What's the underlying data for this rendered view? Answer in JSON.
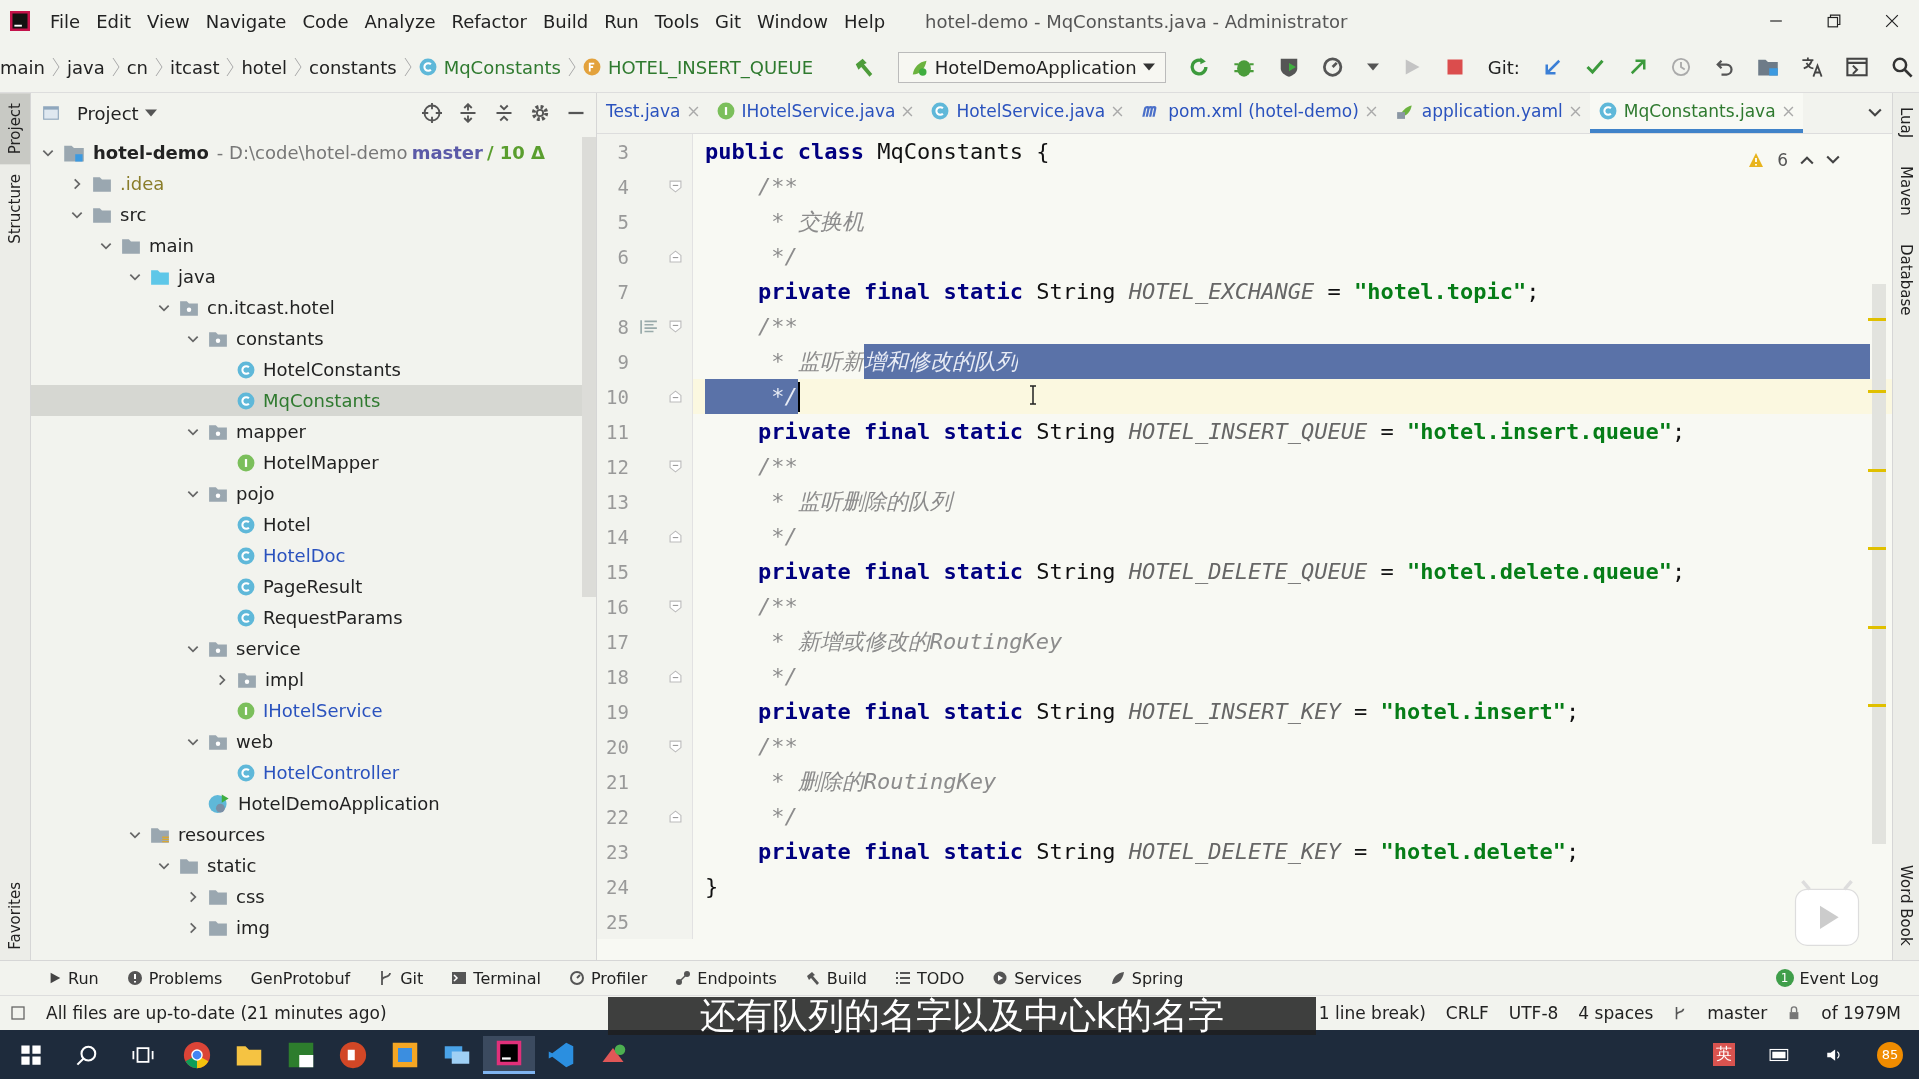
{
  "window": {
    "title": "hotel-demo - MqConstants.java - Administrator"
  },
  "menu": [
    "File",
    "Edit",
    "View",
    "Navigate",
    "Code",
    "Analyze",
    "Refactor",
    "Build",
    "Run",
    "Tools",
    "Git",
    "Window",
    "Help"
  ],
  "breadcrumbs": [
    {
      "label": "main",
      "kind": "plain"
    },
    {
      "label": "java",
      "kind": "plain"
    },
    {
      "label": "cn",
      "kind": "plain"
    },
    {
      "label": "itcast",
      "kind": "plain"
    },
    {
      "label": "hotel",
      "kind": "plain"
    },
    {
      "label": "constants",
      "kind": "plain"
    },
    {
      "label": "MqConstants",
      "kind": "class"
    },
    {
      "label": "HOTEL_INSERT_QUEUE",
      "kind": "field"
    }
  ],
  "run_config": "HotelDemoApplication",
  "git_label": "Git:",
  "left_strip": [
    {
      "label": "Project",
      "selected": true
    },
    {
      "label": "Structure",
      "selected": false
    },
    {
      "label": "Favorites",
      "selected": false
    }
  ],
  "right_strip": [
    "LuaJ",
    "Maven",
    "Database",
    "Word Book"
  ],
  "project": {
    "title": "Project",
    "tree": [
      {
        "label": "hotel-demo",
        "kind": "module",
        "color": "#222222",
        "expanded": true,
        "selected": false,
        "path": "- D:\\code\\hotel-demo",
        "branch": "master",
        "changes": "/ 10 Δ",
        "children": [
          {
            "label": ".idea",
            "kind": "folder",
            "color": "#8a7d2a",
            "expanded": false,
            "selected": false
          },
          {
            "label": "src",
            "kind": "folder",
            "color": "#222222",
            "expanded": true,
            "selected": false,
            "children": [
              {
                "label": "main",
                "kind": "folder",
                "color": "#222222",
                "expanded": true,
                "selected": false,
                "children": [
                  {
                    "label": "java",
                    "kind": "source",
                    "color": "#222222",
                    "expanded": true,
                    "selected": false,
                    "children": [
                      {
                        "label": "cn.itcast.hotel",
                        "kind": "package",
                        "color": "#222222",
                        "expanded": true,
                        "selected": false,
                        "children": [
                          {
                            "label": "constants",
                            "kind": "package",
                            "color": "#222222",
                            "expanded": true,
                            "selected": false,
                            "children": [
                              {
                                "label": "HotelConstants",
                                "kind": "class",
                                "color": "#222222",
                                "selected": false
                              },
                              {
                                "label": "MqConstants",
                                "kind": "class",
                                "color": "#2f7a2f",
                                "selected": true
                              }
                            ]
                          },
                          {
                            "label": "mapper",
                            "kind": "package",
                            "color": "#222222",
                            "expanded": true,
                            "selected": false,
                            "children": [
                              {
                                "label": "HotelMapper",
                                "kind": "interface",
                                "color": "#222222",
                                "selected": false
                              }
                            ]
                          },
                          {
                            "label": "pojo",
                            "kind": "package",
                            "color": "#222222",
                            "expanded": true,
                            "selected": false,
                            "children": [
                              {
                                "label": "Hotel",
                                "kind": "class",
                                "color": "#222222",
                                "selected": false
                              },
                              {
                                "label": "HotelDoc",
                                "kind": "class",
                                "color": "#2a52be",
                                "selected": false
                              },
                              {
                                "label": "PageResult",
                                "kind": "class",
                                "color": "#222222",
                                "selected": false
                              },
                              {
                                "label": "RequestParams",
                                "kind": "class",
                                "color": "#222222",
                                "selected": false
                              }
                            ]
                          },
                          {
                            "label": "service",
                            "kind": "package",
                            "color": "#222222",
                            "expanded": true,
                            "selected": false,
                            "children": [
                              {
                                "label": "impl",
                                "kind": "package",
                                "color": "#222222",
                                "expanded": false,
                                "selected": false
                              },
                              {
                                "label": "IHotelService",
                                "kind": "interface",
                                "color": "#2a52be",
                                "selected": false
                              }
                            ]
                          },
                          {
                            "label": "web",
                            "kind": "package",
                            "color": "#222222",
                            "expanded": true,
                            "selected": false,
                            "children": [
                              {
                                "label": "HotelController",
                                "kind": "class",
                                "color": "#2a52be",
                                "selected": false
                              }
                            ]
                          },
                          {
                            "label": "HotelDemoApplication",
                            "kind": "app",
                            "color": "#222222",
                            "selected": false
                          }
                        ]
                      }
                    ]
                  },
                  {
                    "label": "resources",
                    "kind": "resources",
                    "color": "#222222",
                    "expanded": true,
                    "selected": false,
                    "children": [
                      {
                        "label": "static",
                        "kind": "folder",
                        "color": "#222222",
                        "expanded": true,
                        "selected": false,
                        "children": [
                          {
                            "label": "css",
                            "kind": "folder",
                            "color": "#222222",
                            "expanded": false,
                            "selected": false
                          },
                          {
                            "label": "img",
                            "kind": "folder",
                            "color": "#222222",
                            "expanded": false,
                            "selected": false
                          }
                        ]
                      }
                    ]
                  }
                ]
              }
            ]
          }
        ]
      }
    ]
  },
  "editor": {
    "tabs": [
      {
        "label": "Test.java",
        "kind": "plain",
        "selected": false
      },
      {
        "label": "IHotelService.java",
        "kind": "interface",
        "selected": false
      },
      {
        "label": "HotelService.java",
        "kind": "class",
        "selected": false
      },
      {
        "label": "pom.xml (hotel-demo)",
        "kind": "maven",
        "selected": false
      },
      {
        "label": "application.yaml",
        "kind": "yaml",
        "selected": false
      },
      {
        "label": "MqConstants.java",
        "kind": "class",
        "selected": true
      }
    ],
    "warnings": "6",
    "lines": [
      {
        "number": "3",
        "kind": "plain",
        "tokens": [
          {
            "kind": "kw",
            "t": "public class ",
            "selected": false
          },
          {
            "kind": "plain",
            "t": "MqConstants {",
            "selected": false
          }
        ]
      },
      {
        "number": "4",
        "kind": "foldstart",
        "tokens": [
          {
            "kind": "comment",
            "t": "    /**",
            "selected": false
          }
        ]
      },
      {
        "number": "5",
        "kind": "plain",
        "tokens": [
          {
            "kind": "comment",
            "t": "     * 交换机",
            "selected": false
          }
        ]
      },
      {
        "number": "6",
        "kind": "foldend",
        "tokens": [
          {
            "kind": "comment",
            "t": "     */",
            "selected": false
          }
        ]
      },
      {
        "number": "7",
        "kind": "plain",
        "tokens": [
          {
            "kind": "kw",
            "t": "    private final static ",
            "selected": false
          },
          {
            "kind": "plain",
            "t": "String ",
            "selected": false
          },
          {
            "kind": "field",
            "t": "HOTEL_EXCHANGE",
            "selected": false
          },
          {
            "kind": "plain",
            "t": " = ",
            "selected": false
          },
          {
            "kind": "string",
            "t": "\"hotel.topic\"",
            "selected": false
          },
          {
            "kind": "plain",
            "t": ";",
            "selected": false
          }
        ]
      },
      {
        "number": "8",
        "kind": "foldstart",
        "doc_icon": true,
        "tokens": [
          {
            "kind": "comment",
            "t": "    /**",
            "selected": false
          }
        ]
      },
      {
        "number": "9",
        "kind": "plain",
        "selection_to_end": true,
        "tokens": [
          {
            "kind": "comment",
            "t": "     * 监听新",
            "selected": false
          },
          {
            "kind": "comment",
            "t": "增和修改的队列",
            "selected": true
          }
        ]
      },
      {
        "number": "10",
        "kind": "foldend",
        "current": true,
        "caret": true,
        "tokens": [
          {
            "kind": "comment",
            "t": "     */",
            "selected": true
          }
        ]
      },
      {
        "number": "11",
        "kind": "plain",
        "tokens": [
          {
            "kind": "kw",
            "t": "    private final static ",
            "selected": false
          },
          {
            "kind": "plain",
            "t": "String ",
            "selected": false
          },
          {
            "kind": "field",
            "t": "HOTEL_INSERT_QUEUE",
            "selected": false
          },
          {
            "kind": "plain",
            "t": " = ",
            "selected": false
          },
          {
            "kind": "string",
            "t": "\"hotel.insert.queue\"",
            "selected": false
          },
          {
            "kind": "plain",
            "t": ";",
            "selected": false
          }
        ]
      },
      {
        "number": "12",
        "kind": "foldstart",
        "tokens": [
          {
            "kind": "comment",
            "t": "    /**",
            "selected": false
          }
        ]
      },
      {
        "number": "13",
        "kind": "plain",
        "tokens": [
          {
            "kind": "comment",
            "t": "     * 监听删除的队列",
            "selected": false
          }
        ]
      },
      {
        "number": "14",
        "kind": "foldend",
        "tokens": [
          {
            "kind": "comment",
            "t": "     */",
            "selected": false
          }
        ]
      },
      {
        "number": "15",
        "kind": "plain",
        "tokens": [
          {
            "kind": "kw",
            "t": "    private final static ",
            "selected": false
          },
          {
            "kind": "plain",
            "t": "String ",
            "selected": false
          },
          {
            "kind": "field",
            "t": "HOTEL_DELETE_QUEUE",
            "selected": false
          },
          {
            "kind": "plain",
            "t": " = ",
            "selected": false
          },
          {
            "kind": "string",
            "t": "\"hotel.delete.queue\"",
            "selected": false
          },
          {
            "kind": "plain",
            "t": ";",
            "selected": false
          }
        ]
      },
      {
        "number": "16",
        "kind": "foldstart",
        "tokens": [
          {
            "kind": "comment",
            "t": "    /**",
            "selected": false
          }
        ]
      },
      {
        "number": "17",
        "kind": "plain",
        "tokens": [
          {
            "kind": "comment",
            "t": "     * 新增或修改的RoutingKey",
            "selected": false
          }
        ]
      },
      {
        "number": "18",
        "kind": "foldend",
        "tokens": [
          {
            "kind": "comment",
            "t": "     */",
            "selected": false
          }
        ]
      },
      {
        "number": "19",
        "kind": "plain",
        "tokens": [
          {
            "kind": "kw",
            "t": "    private final static ",
            "selected": false
          },
          {
            "kind": "plain",
            "t": "String ",
            "selected": false
          },
          {
            "kind": "field",
            "t": "HOTEL_INSERT_KEY",
            "selected": false
          },
          {
            "kind": "plain",
            "t": " = ",
            "selected": false
          },
          {
            "kind": "string",
            "t": "\"hotel.insert\"",
            "selected": false
          },
          {
            "kind": "plain",
            "t": ";",
            "selected": false
          }
        ]
      },
      {
        "number": "20",
        "kind": "foldstart",
        "tokens": [
          {
            "kind": "comment",
            "t": "    /**",
            "selected": false
          }
        ]
      },
      {
        "number": "21",
        "kind": "plain",
        "tokens": [
          {
            "kind": "comment",
            "t": "     * 删除的RoutingKey",
            "selected": false
          }
        ]
      },
      {
        "number": "22",
        "kind": "foldend",
        "tokens": [
          {
            "kind": "comment",
            "t": "     */",
            "selected": false
          }
        ]
      },
      {
        "number": "23",
        "kind": "plain",
        "tokens": [
          {
            "kind": "kw",
            "t": "    private final static ",
            "selected": false
          },
          {
            "kind": "plain",
            "t": "String ",
            "selected": false
          },
          {
            "kind": "field",
            "t": "HOTEL_DELETE_KEY",
            "selected": false
          },
          {
            "kind": "plain",
            "t": " = ",
            "selected": false
          },
          {
            "kind": "string",
            "t": "\"hotel.delete\"",
            "selected": false
          },
          {
            "kind": "plain",
            "t": ";",
            "selected": false
          }
        ]
      },
      {
        "number": "24",
        "kind": "plain",
        "tokens": [
          {
            "kind": "plain",
            "t": "}",
            "selected": false
          }
        ]
      },
      {
        "number": "25",
        "kind": "plain"
      }
    ]
  },
  "tool_windows": [
    {
      "label": "Run",
      "kind": "run"
    },
    {
      "label": "Problems",
      "kind": "problems"
    },
    {
      "label": "GenProtobuf",
      "kind": "none"
    },
    {
      "label": "Git",
      "kind": "git"
    },
    {
      "label": "Terminal",
      "kind": "terminal"
    },
    {
      "label": "Profiler",
      "kind": "profiler"
    },
    {
      "label": "Endpoints",
      "kind": "endpoints"
    },
    {
      "label": "Build",
      "kind": "build"
    },
    {
      "label": "TODO",
      "kind": "todo"
    },
    {
      "label": "Services",
      "kind": "services"
    },
    {
      "label": "Spring",
      "kind": "spring"
    }
  ],
  "event_log": {
    "label": "Event Log",
    "count": "1"
  },
  "status_bar": {
    "message": "All files are up-to-date (21 minutes ago)",
    "items": [
      "1 line break)",
      "CRLF",
      "UTF-8",
      "4 spaces",
      "master",
      "of 1979M"
    ]
  },
  "subtitle": "还有队列的名字以及中心k的名字",
  "taskbar": {
    "apps": [
      {
        "kind": "chrome",
        "selected": false
      },
      {
        "kind": "explorer",
        "selected": false
      },
      {
        "kind": "notes",
        "selected": false
      },
      {
        "kind": "slides",
        "selected": false
      },
      {
        "kind": "window",
        "selected": false
      },
      {
        "kind": "remote",
        "selected": false
      },
      {
        "kind": "ide",
        "selected": true
      },
      {
        "kind": "code",
        "selected": false
      },
      {
        "kind": "tool",
        "selected": false
      }
    ],
    "ime": "英",
    "badge": "85"
  }
}
